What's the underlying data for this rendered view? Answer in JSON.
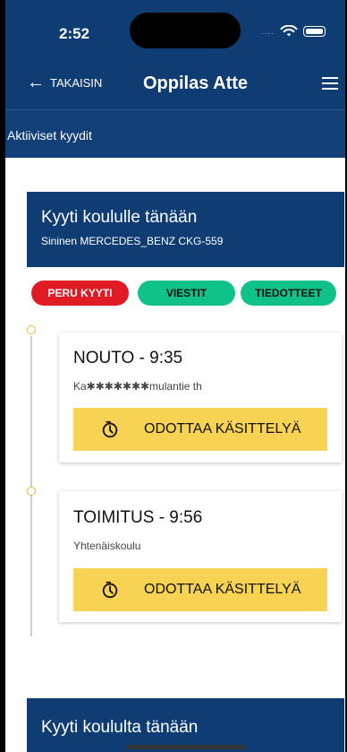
{
  "status_bar": {
    "time": "2:52",
    "dots": "....",
    "wifi_icon": "wifi-icon",
    "battery_icon": "battery-icon"
  },
  "header": {
    "back_label": "TAKAISIN",
    "back_icon": "arrow-left-icon",
    "title": "Oppilas Atte",
    "menu_icon": "hamburger-menu-icon"
  },
  "subheader": {
    "label": "Aktiiviset kyydit"
  },
  "ride_today": {
    "title": "Kyyti koululle tänään",
    "vehicle": "Sininen MERCEDES_BENZ CKG-559"
  },
  "actions": {
    "cancel": "PERU KYYTI",
    "messages": "VIESTIT",
    "notices": "TIEDOTTEET"
  },
  "stops": [
    {
      "title": "NOUTO - 9:35",
      "address": "Ka✱✱✱✱✱✱✱mulantie th",
      "status": "ODOTTAA KÄSITTELYÄ"
    },
    {
      "title": "TOIMITUS - 9:56",
      "address": "Yhtenäiskoulu",
      "status": "ODOTTAA KÄSITTELYÄ"
    }
  ],
  "ride_return": {
    "title": "Kyyti koululta tänään"
  },
  "colors": {
    "navy": "#0f3d73",
    "red": "#e11b24",
    "green": "#10c28a",
    "yellow": "#f7d253"
  }
}
